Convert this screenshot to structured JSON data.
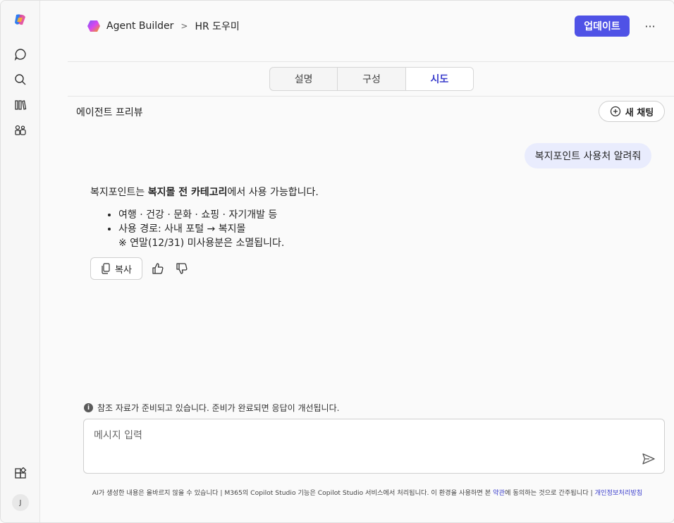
{
  "header": {
    "app_name": "Agent Builder",
    "agent_name": "HR 도우미",
    "update_label": "업데이트",
    "more_label": "···"
  },
  "tabs": [
    {
      "label": "설명",
      "active": false
    },
    {
      "label": "구성",
      "active": false
    },
    {
      "label": "시도",
      "active": true
    }
  ],
  "preview": {
    "title": "에이전트 프리뷰",
    "new_chat_label": "새 채팅"
  },
  "chat": {
    "user_message": "복지포인트 사용처 알려줘",
    "answer": {
      "intro_prefix": "복지포인트는 ",
      "intro_bold": "복지몰 전 카테고리",
      "intro_suffix": "에서 사용 가능합니다.",
      "bullet_1": "여행 · 건강 · 문화 · 쇼핑 · 자기개발 등",
      "bullet_2": "사용 경로: 사내 포털 → 복지몰",
      "note": "※ 연말(12/31) 미사용분은 소멸됩니다."
    },
    "copy_label": "복사"
  },
  "notice": {
    "icon_text": "i",
    "text": "참조 자료가 준비되고 있습니다. 준비가 완료되면 응답이 개선됩니다."
  },
  "input": {
    "placeholder": "메시지 입력"
  },
  "disclaimer": {
    "text_main": "AI가 생성한 내용은 올바르지 않을 수 있습니다 | M365의 Copilot Studio 기능은 Copilot Studio 서비스에서 처리됩니다. 이 환경을 사용하면 본 ",
    "terms_link": "약관",
    "text_mid": "에 동의하는 것으로 간주됩니다 | ",
    "privacy_link": "개인정보처리방침"
  },
  "user": {
    "initial": "J"
  },
  "colors": {
    "accent": "#4f52e6",
    "bubble": "#e9ecfd",
    "link": "#3a3dcc"
  }
}
